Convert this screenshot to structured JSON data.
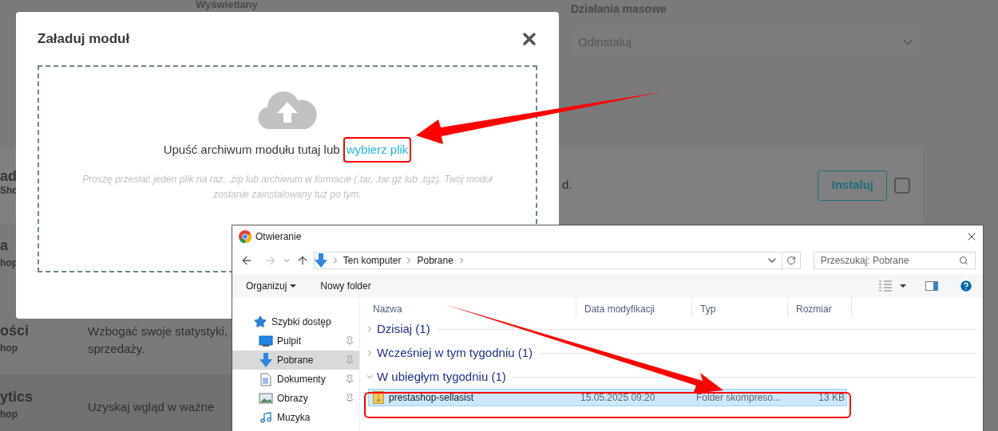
{
  "background": {
    "column_label": "Wyświetlany",
    "bulk_actions": {
      "label": "Działania masowe",
      "value": "Odinstaluj"
    },
    "card": {
      "title": "ad",
      "subtitle": "Sho",
      "description": "d.",
      "install_button": "Instaluj",
      "checked": false
    },
    "rows": [
      {
        "title": "a",
        "subtitle": "hop",
        "description": []
      },
      {
        "title": "ości",
        "subtitle": "hop",
        "description": [
          "Wzbogać swoje statystyki,",
          "sprzedaży."
        ]
      },
      {
        "title": "ytics",
        "subtitle": "hop",
        "description": [
          "Uzyskaj wgląd w ważne"
        ]
      }
    ]
  },
  "modal": {
    "title": "Załaduj moduł",
    "drop_text": "Upuść archiwum modułu tutaj lub",
    "link": "wybierz plik",
    "hint": "Proszę przesłać jeden plik na raz, .zip lub archiwum w formacie (.tar, .tar.gz lub .tgz). Twój moduł zostanie zainstalowany tuż po tym."
  },
  "dialog": {
    "title": "Otwieranie",
    "breadcrumb": [
      "Ten komputer",
      "Pobrane"
    ],
    "search": {
      "placeholder": "Przeszukaj: Pobrane"
    },
    "toolbar": {
      "organize": "Organizuj",
      "new_folder": "Nowy folder"
    },
    "nav": [
      {
        "kind": "star",
        "label": "Szybki dostęp",
        "selected": false,
        "pinned": false
      },
      {
        "kind": "desktop",
        "label": "Pulpit",
        "selected": false,
        "pinned": true
      },
      {
        "kind": "download",
        "label": "Pobrane",
        "selected": true,
        "pinned": true
      },
      {
        "kind": "document",
        "label": "Dokumenty",
        "selected": false,
        "pinned": true
      },
      {
        "kind": "image",
        "label": "Obrazy",
        "selected": false,
        "pinned": true
      },
      {
        "kind": "music",
        "label": "Muzyka",
        "selected": false,
        "pinned": false
      }
    ],
    "columns": [
      "Nazwa",
      "Data modyfikacji",
      "Typ",
      "Rozmiar"
    ],
    "groups": [
      {
        "label": "Dzisiaj (1)",
        "expanded": false
      },
      {
        "label": "Wcześniej w tym tygodniu (1)",
        "expanded": false
      },
      {
        "label": "W ubiegłym tygodniu (1)",
        "expanded": true,
        "files": [
          {
            "name": "prestashop-sellasist",
            "date": "15.05.2025 09:20",
            "type": "Folder skompreso...",
            "size": "13 KB",
            "selected": true
          }
        ]
      }
    ]
  }
}
